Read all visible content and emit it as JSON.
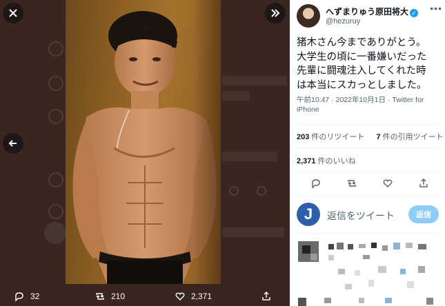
{
  "media": {
    "reply_count": "32",
    "retweet_count": "210",
    "like_count": "2,371"
  },
  "tweet": {
    "author_name": "へずまりゅう原田将大",
    "author_handle": "@hezuruy",
    "text_lines": [
      "猪木さん今までありがとう。",
      "大学生の頃に一番嫌いだった",
      "先輩に闘魂注入してくれた時",
      "は本当にスカっとしました。"
    ],
    "meta_time": "午前10:47 · 2022年10月1日 · Twitter for",
    "meta_app": "iPhone",
    "retweets_number": "203",
    "retweets_label": " 件のリツイート",
    "quotes_number": "7",
    "quotes_label": " 件の引用ツイート",
    "likes_number": "2,371",
    "likes_label": " 件のいいね",
    "reply_avatar_letter": "J",
    "reply_placeholder": "返信をツイート",
    "reply_button_label": "返信"
  },
  "icons": {
    "close": "x-icon",
    "prev": "arrow-left-icon",
    "expand": "double-chevron-right-icon",
    "more": "more-dots-icon",
    "verified": "verified-badge-icon",
    "reply": "reply-icon",
    "retweet": "retweet-icon",
    "like": "heart-icon",
    "share": "share-icon"
  },
  "colors": {
    "brand_blue": "#1d9bf0",
    "backdrop": "#3b2521",
    "reply_button": "#8ecdf8"
  }
}
